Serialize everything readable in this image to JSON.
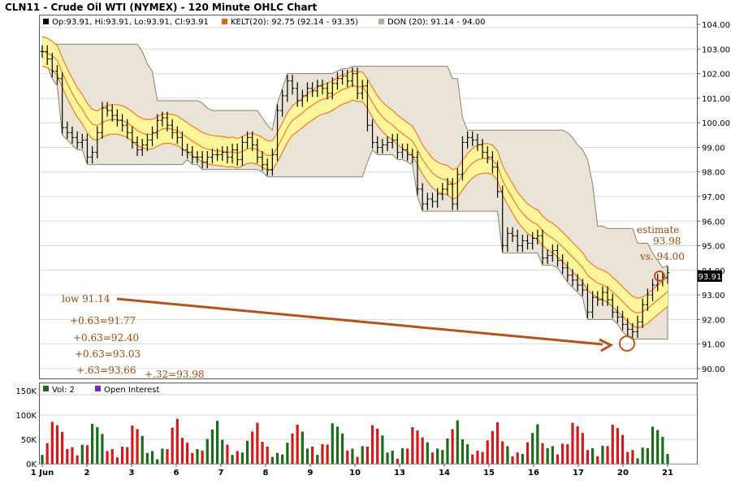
{
  "title": "CLN11 - Crude Oil WTI (NYMEX) - 120 Minute OHLC Chart",
  "legend_price": {
    "ohlc": "Op:93.91, Hi:93.91, Lo:93.91, Cl:93.91",
    "kelt": "KELT(20): 92.75 (92.14 - 93.35)",
    "don": "DON (20): 91.14 - 94.00"
  },
  "legend_volume": {
    "vol": "Vol: 2",
    "oi": "Open Interest"
  },
  "last_price_label": "93.91",
  "annotations": {
    "low": "low 91.14",
    "steps": [
      "+0.63=91.77",
      "+0.63=92.40",
      "+0.63=93.03",
      "+.63=93.66",
      "+.32=93.98"
    ],
    "estimate": [
      "estimate",
      "93.98",
      "vs. 94.00"
    ]
  },
  "colors": {
    "up_bar": "#1a6b1a",
    "down_bar": "#d11a1a",
    "keltner_line": "#f07b2a",
    "keltner_fill": "#fff59a",
    "donchian_fill": "#e9e4d6",
    "donchian_line": "#8a8270",
    "annotation": "#9a4a12",
    "ohlc_bar": "#000000"
  },
  "chart_data": {
    "type": "ohlc",
    "price_axis": {
      "ylim": [
        89.6,
        104.4
      ],
      "ticks": [
        "90.00",
        "91.00",
        "92.00",
        "93.00",
        "94.00",
        "95.00",
        "96.00",
        "97.00",
        "98.00",
        "99.00",
        "100.00",
        "101.00",
        "102.00",
        "103.00",
        "104.00"
      ]
    },
    "volume_axis": {
      "ylim": [
        0,
        165000
      ],
      "ticks": [
        "0K",
        "50K",
        "100K",
        "150K"
      ]
    },
    "x_tick_labels": [
      "1 Jun",
      "2",
      "3",
      "6",
      "7",
      "8",
      "9",
      "10",
      "13",
      "14",
      "15",
      "16",
      "17",
      "20",
      "21"
    ],
    "closes": [
      102.9,
      102.6,
      102.1,
      101.8,
      99.8,
      99.6,
      99.4,
      99.2,
      99.3,
      98.6,
      98.8,
      99.6,
      100.6,
      100.5,
      100.3,
      100.1,
      99.9,
      99.6,
      99.2,
      98.9,
      99.1,
      99.3,
      99.6,
      100.1,
      100.2,
      99.9,
      99.6,
      99.4,
      98.9,
      98.8,
      98.6,
      98.6,
      98.4,
      98.6,
      98.7,
      98.7,
      98.8,
      98.6,
      98.9,
      98.5,
      99.2,
      99.4,
      99.1,
      98.6,
      98.3,
      98.1,
      98.7,
      100.5,
      101.1,
      101.7,
      101.4,
      100.9,
      101.1,
      101.4,
      101.3,
      101.5,
      101.4,
      101.2,
      101.6,
      101.8,
      101.9,
      101.7,
      102.0,
      101.2,
      101.5,
      99.9,
      99.2,
      99.0,
      99.1,
      99.2,
      99.3,
      98.8,
      98.9,
      98.7,
      98.6,
      97.3,
      96.7,
      96.9,
      96.8,
      97.1,
      97.3,
      97.5,
      96.7,
      97.9,
      99.2,
      99.4,
      99.3,
      99.1,
      98.8,
      98.6,
      98.2,
      97.2,
      95.0,
      95.5,
      95.4,
      95.0,
      95.2,
      95.1,
      95.3,
      95.4,
      94.5,
      94.6,
      94.8,
      94.4,
      94.1,
      93.8,
      93.6,
      93.4,
      93.2,
      92.3,
      92.9,
      92.8,
      93.1,
      92.8,
      92.3,
      92.1,
      91.8,
      91.6,
      91.5,
      91.9,
      92.6,
      93.0,
      93.4,
      93.6,
      93.7,
      93.9
    ]
  }
}
